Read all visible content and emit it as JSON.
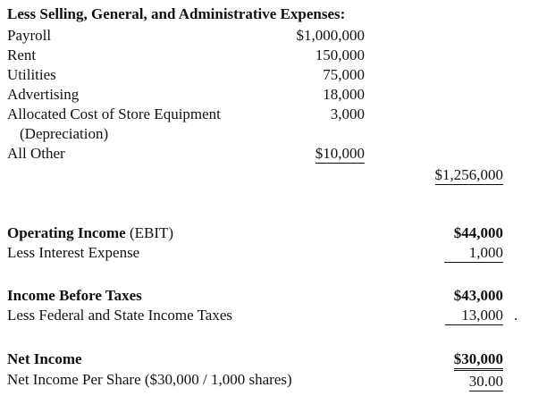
{
  "statement": {
    "sga_header": "Less Selling, General, and Administrative Expenses:",
    "expenses": [
      {
        "label": "Payroll",
        "amount": "$1,000,000"
      },
      {
        "label": "Rent",
        "amount": "150,000"
      },
      {
        "label": "Utilities",
        "amount": "75,000"
      },
      {
        "label": "Advertising",
        "amount": "18,000"
      },
      {
        "label": "Allocated Cost of Store Equipment",
        "label2": "(Depreciation)",
        "amount": "3,000"
      },
      {
        "label": "All Other",
        "amount": "$10,000"
      }
    ],
    "sga_total": "$1,256,000",
    "operating_income": {
      "label": "Operating Income",
      "suffix": " (EBIT)",
      "amount": "$44,000"
    },
    "interest": {
      "label": "Less Interest Expense",
      "amount": "1,000"
    },
    "income_before_taxes": {
      "label": "Income Before Taxes",
      "amount": "$43,000"
    },
    "taxes": {
      "label": "Less Federal and State Income Taxes",
      "amount": "13,000",
      "trailing": "."
    },
    "net_income": {
      "label": "Net Income",
      "amount": "$30,000"
    },
    "eps": {
      "label": "Net Income Per Share ($30,000 / 1,000 shares)",
      "amount": "30.00"
    }
  }
}
